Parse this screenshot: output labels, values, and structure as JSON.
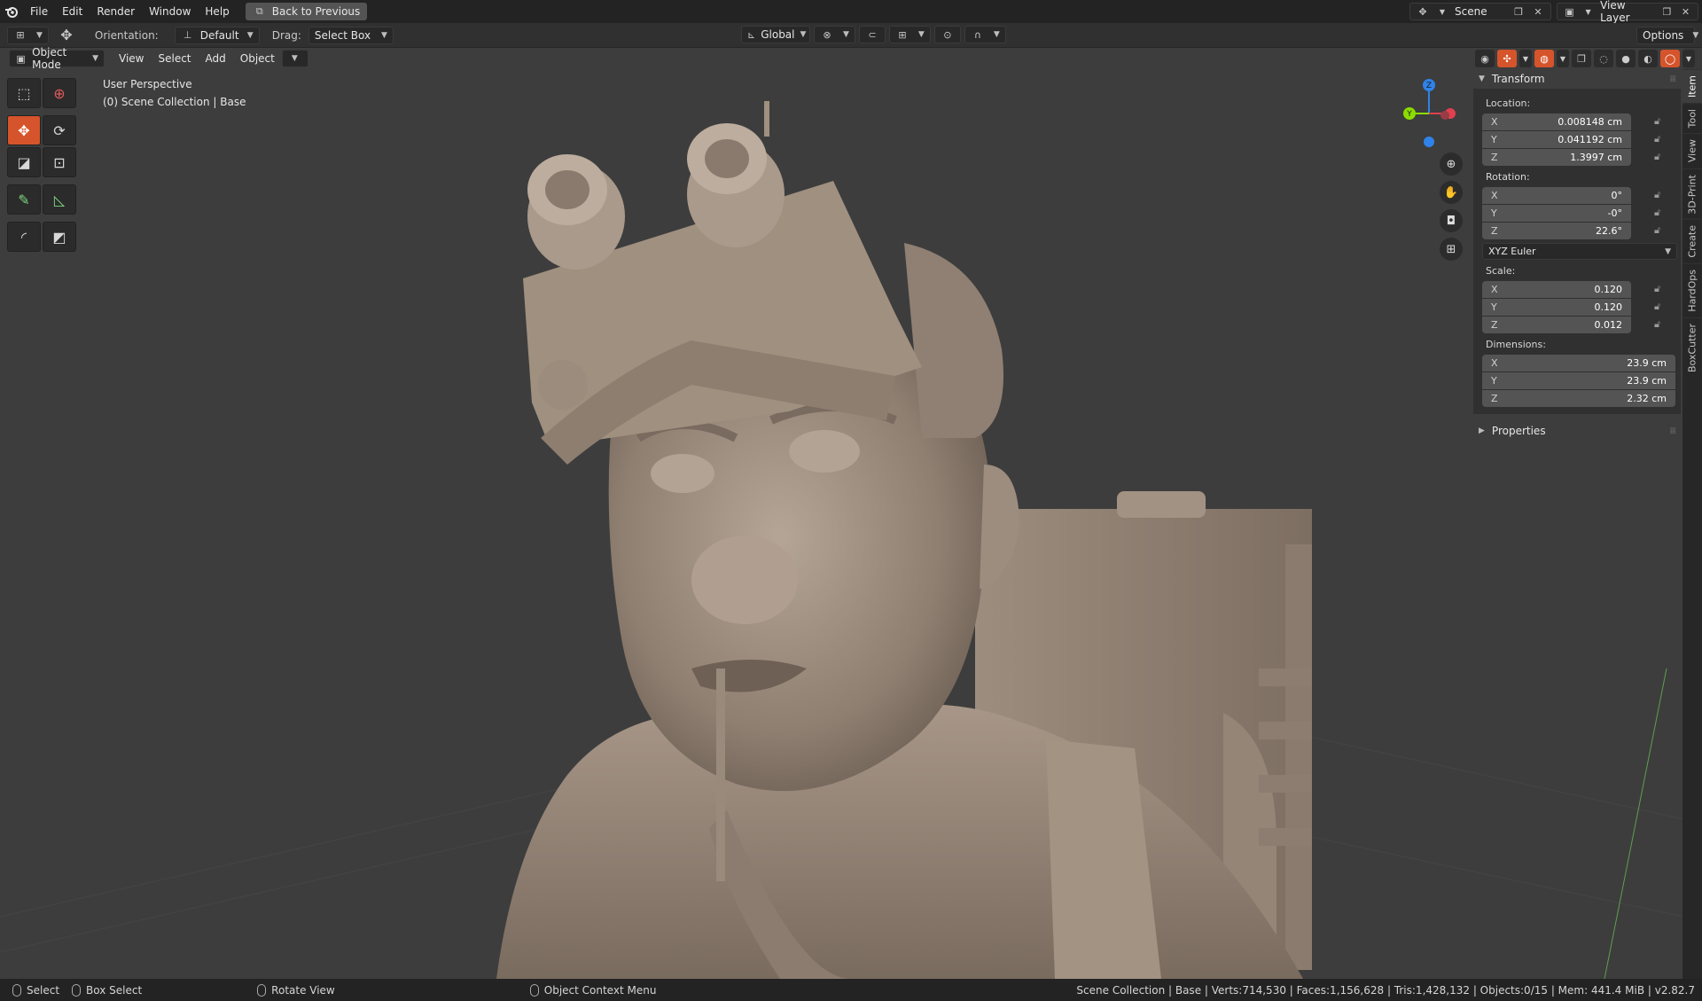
{
  "menubar": {
    "items": [
      "File",
      "Edit",
      "Render",
      "Window",
      "Help"
    ],
    "back_button": "Back to Previous",
    "scene": "Scene",
    "view_layer": "View Layer"
  },
  "tool_settings": {
    "orientation_label": "Orientation:",
    "orientation_value": "Default",
    "drag_label": "Drag:",
    "drag_value": "Select Box",
    "transform_orientation": "Global",
    "options_label": "Options"
  },
  "viewport_header": {
    "mode": "Object Mode",
    "menus": [
      "View",
      "Select",
      "Add",
      "Object"
    ]
  },
  "viewport": {
    "perspective": "User Perspective",
    "collection": "(0) Scene Collection | Base"
  },
  "gizmo": {
    "axes": [
      "Z",
      "Y"
    ],
    "colors": {
      "x": "#e0404f",
      "y": "#8bdc00",
      "z": "#2f83e8"
    }
  },
  "npanel": {
    "transform_title": "Transform",
    "location_label": "Location:",
    "location": [
      {
        "axis": "X",
        "value": "0.008148 cm"
      },
      {
        "axis": "Y",
        "value": "0.041192 cm"
      },
      {
        "axis": "Z",
        "value": "1.3997 cm"
      }
    ],
    "rotation_label": "Rotation:",
    "rotation": [
      {
        "axis": "X",
        "value": "0°"
      },
      {
        "axis": "Y",
        "value": "-0°"
      },
      {
        "axis": "Z",
        "value": "22.6°"
      }
    ],
    "rotation_mode": "XYZ Euler",
    "scale_label": "Scale:",
    "scale": [
      {
        "axis": "X",
        "value": "0.120"
      },
      {
        "axis": "Y",
        "value": "0.120"
      },
      {
        "axis": "Z",
        "value": "0.012"
      }
    ],
    "dimensions_label": "Dimensions:",
    "dimensions": [
      {
        "axis": "X",
        "value": "23.9 cm"
      },
      {
        "axis": "Y",
        "value": "23.9 cm"
      },
      {
        "axis": "Z",
        "value": "2.32 cm"
      }
    ],
    "properties_title": "Properties"
  },
  "sidebar_tabs": [
    "Item",
    "Tool",
    "View",
    "3D-Print",
    "Create",
    "HardOps",
    "BoxCutter"
  ],
  "statusbar": {
    "select": "Select",
    "box_select": "Box Select",
    "rotate_view": "Rotate View",
    "context_menu": "Object Context Menu",
    "stats": "Scene Collection | Base | Verts:714,530 | Faces:1,156,628 | Tris:1,428,132 | Objects:0/15 | Mem: 441.4 MiB | v2.82.7"
  },
  "accent_color": "#d5542b",
  "icons": [
    "blender-logo-icon",
    "back-icon",
    "scene-icon",
    "view-layer-icon",
    "select-box-tool-icon",
    "cursor-tool-icon",
    "move-tool-icon",
    "rotate-tool-icon",
    "scale-tool-icon",
    "transform-tool-icon",
    "annotate-tool-icon",
    "measure-tool-icon",
    "zoom-icon",
    "hand-pan-icon",
    "camera-icon",
    "grid-icon",
    "lock-icon"
  ]
}
